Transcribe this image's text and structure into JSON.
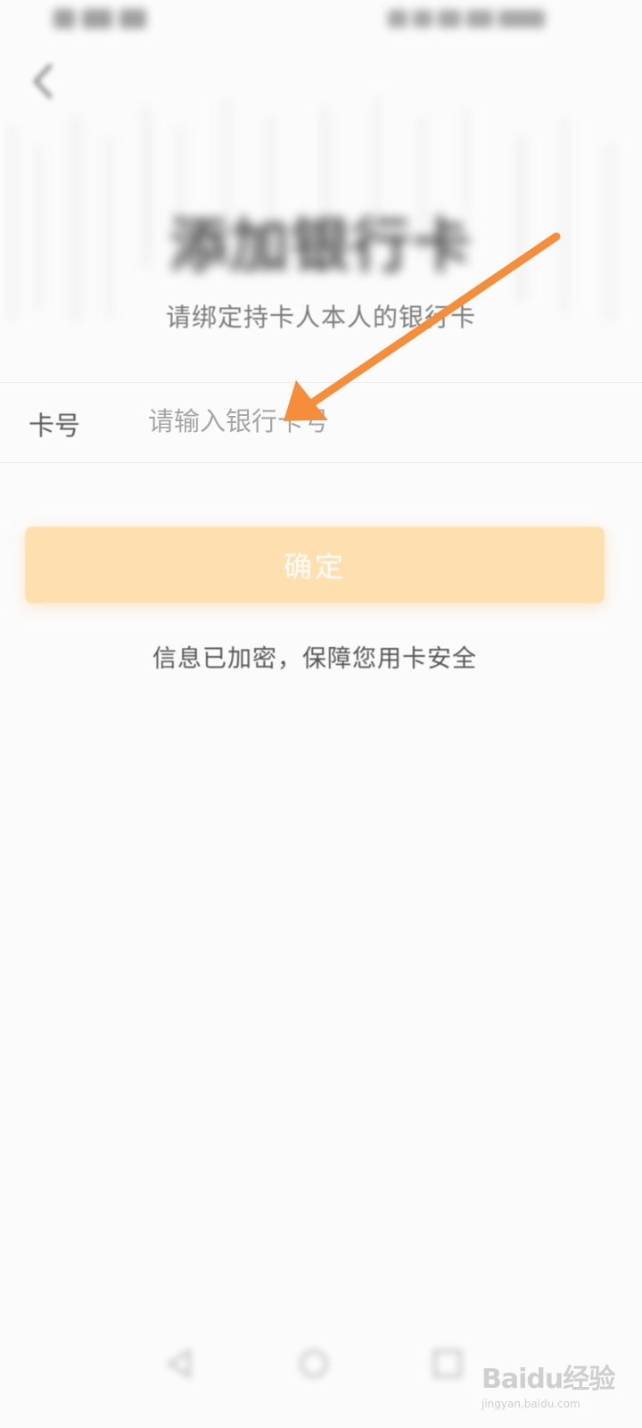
{
  "header": {
    "back_icon": "chevron-left-icon"
  },
  "main": {
    "title": "添加银行卡",
    "subtitle": "请绑定持卡人本人的银行卡",
    "card_field": {
      "label": "卡号",
      "placeholder": "请输入银行卡号",
      "value": ""
    },
    "confirm_label": "确定",
    "secure_note": "信息已加密，保障您用卡安全"
  },
  "watermark": {
    "brand": "Baidu经验",
    "url": "jingyan.baidu.com"
  },
  "colors": {
    "confirm_button_bg": "#fedfb0",
    "annotation_arrow": "#f58d3b",
    "background": "#fbfbfb"
  }
}
